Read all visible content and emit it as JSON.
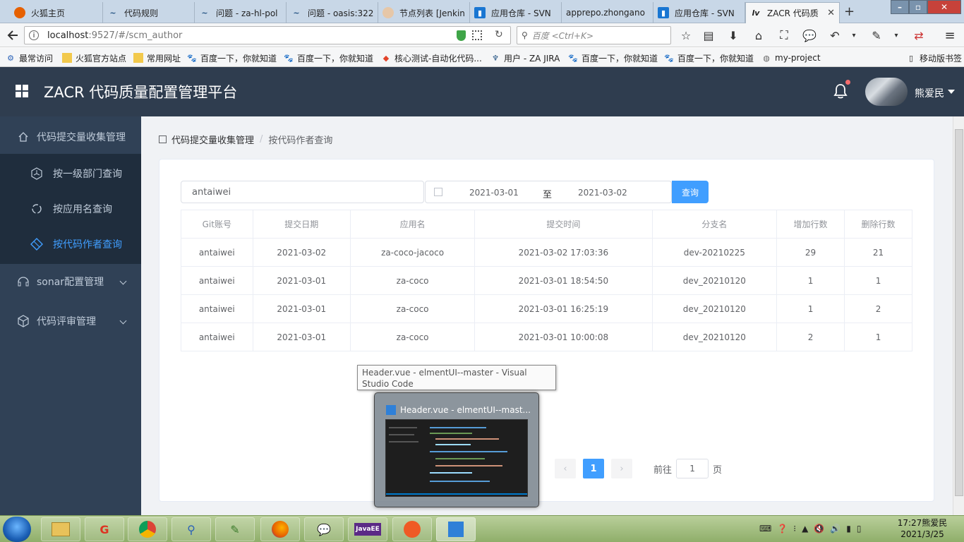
{
  "browser": {
    "tabs": [
      {
        "label": "火狐主页",
        "icon": "firefox-icon",
        "color": "#e66000"
      },
      {
        "label": "代码规则",
        "icon": "confluence-icon",
        "color": "#205081"
      },
      {
        "label": "问题 - za-hl-pol",
        "icon": "confluence-icon",
        "color": "#205081"
      },
      {
        "label": "问题 - oasis:322",
        "icon": "confluence-icon",
        "color": "#205081"
      },
      {
        "label": "节点列表 [Jenkin",
        "icon": "jenkins-icon",
        "color": "#a05a2c"
      },
      {
        "label": "应用仓库 - SVN",
        "icon": "svn-icon",
        "color": "#1976d2"
      },
      {
        "label": "apprepo.zhongano",
        "icon": "blank-icon",
        "color": "#888888"
      },
      {
        "label": "应用仓库 - SVN",
        "icon": "svn-icon",
        "color": "#1976d2"
      },
      {
        "label": "ZACR 代码质",
        "icon": "app-icon",
        "color": "#333333"
      }
    ],
    "new_tab": "+",
    "url_host": "localhost",
    "url_path": ":9527/#/scm_author",
    "search_placeholder": "百度 <Ctrl+K>",
    "bookmarks": [
      {
        "label": "最常访问",
        "icon": "gear-icon"
      },
      {
        "label": "火狐官方站点",
        "icon": "folder-icon"
      },
      {
        "label": "常用网址",
        "icon": "folder-icon"
      },
      {
        "label": "百度一下，你就知道",
        "icon": "baidu-icon"
      },
      {
        "label": "百度一下，你就知道",
        "icon": "baidu-icon"
      },
      {
        "label": "核心测试-自动化代码...",
        "icon": "gitlab-icon"
      },
      {
        "label": "用户 - ZA JIRA",
        "icon": "jira-icon"
      },
      {
        "label": "百度一下，你就知道",
        "icon": "baidu-icon"
      },
      {
        "label": "百度一下，你就知道",
        "icon": "baidu-icon"
      },
      {
        "label": "my-project",
        "icon": "globe-icon"
      }
    ],
    "mobile_bookmarks": "移动版书签"
  },
  "header": {
    "title": "ZACR 代码质量配置管理平台",
    "username": "熊爱民"
  },
  "sidebar": {
    "items": [
      {
        "label": "代码提交量收集管理",
        "icon": "home-icon",
        "level": 1,
        "active": false,
        "caret": false
      },
      {
        "label": "按一级部门查询",
        "icon": "hexagon-icon",
        "level": 2,
        "active": false,
        "caret": false
      },
      {
        "label": "按应用名查询",
        "icon": "refresh-icon",
        "level": 2,
        "active": false,
        "caret": false
      },
      {
        "label": "按代码作者查询",
        "icon": "diamond-icon",
        "level": 2,
        "active": true,
        "caret": false
      },
      {
        "label": "sonar配置管理",
        "icon": "sonar-icon",
        "level": 1,
        "active": false,
        "caret": true
      },
      {
        "label": "代码评审管理",
        "icon": "cube-icon",
        "level": 1,
        "active": false,
        "caret": true
      }
    ]
  },
  "breadcrumb": {
    "root": "代码提交量收集管理",
    "separator": "/",
    "current": "按代码作者查询"
  },
  "filters": {
    "author": "antaiwei",
    "start_date": "2021-03-01",
    "range_separator": "至",
    "end_date": "2021-03-02",
    "query_label": "查询"
  },
  "table": {
    "columns": [
      "Git账号",
      "提交日期",
      "应用名",
      "提交时间",
      "分支名",
      "增加行数",
      "删除行数"
    ],
    "rows": [
      [
        "antaiwei",
        "2021-03-02",
        "za-coco-jacoco",
        "2021-03-02 17:03:36",
        "dev-20210225",
        "29",
        "21"
      ],
      [
        "antaiwei",
        "2021-03-01",
        "za-coco",
        "2021-03-01 18:54:50",
        "dev_20210120",
        "1",
        "1"
      ],
      [
        "antaiwei",
        "2021-03-01",
        "za-coco",
        "2021-03-01 16:25:19",
        "dev_20210120",
        "1",
        "2"
      ],
      [
        "antaiwei",
        "2021-03-01",
        "za-coco",
        "2021-03-01 10:00:08",
        "dev_20210120",
        "2",
        "1"
      ]
    ]
  },
  "pagination": {
    "current_page": "1",
    "goto_label": "前往",
    "goto_value": "1",
    "page_suffix": "页"
  },
  "taskbar_preview": {
    "tooltip": "Header.vue - elmentUI--master - Visual Studio Code",
    "title": "Header.vue - elmentUI--mast..."
  },
  "taskbar": {
    "apps": [
      "file-explorer-icon",
      "app-g-icon",
      "chrome-icon",
      "search-app-icon",
      "notepad-icon",
      "firefox-icon",
      "wechat-icon",
      "java-ee-ide-icon",
      "postman-icon",
      "vscode-icon"
    ],
    "clock_time": "17:27",
    "clock_user": "熊爱民",
    "clock_date": "2021/3/25"
  },
  "colors": {
    "primary": "#409eff",
    "sidebar_bg": "#304156",
    "header_bg": "#2f3d4f"
  }
}
